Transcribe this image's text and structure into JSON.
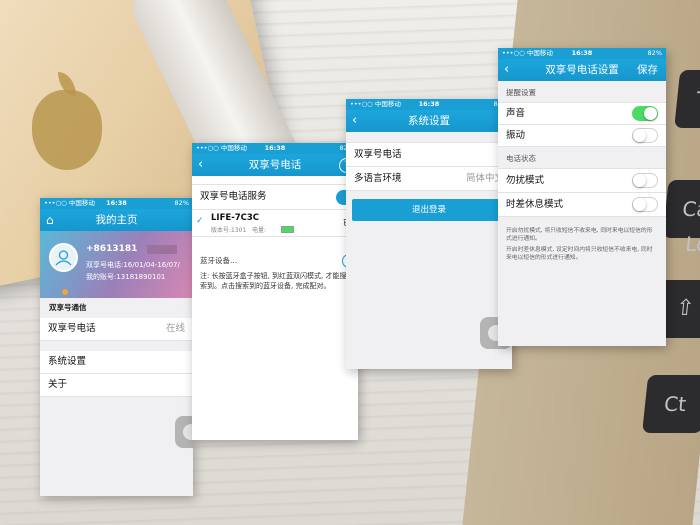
{
  "statusbar": {
    "carrier": "•••○○ 中国移动 ",
    "time": "16:38",
    "battery": "82%"
  },
  "screen1": {
    "title": "我的主页",
    "profile": {
      "phone": "+8613181",
      "date_line": "双享号电话:16/01/04-16/07/",
      "account_line": "我的账号:13181890101"
    },
    "section": "双享号通信",
    "rows": [
      {
        "label": "双享号电话",
        "value": "在线"
      },
      {
        "label": "系统设置"
      },
      {
        "label": "关于"
      }
    ]
  },
  "screen2": {
    "title": "双享号电话",
    "service_label": "双享号电话服务",
    "device": {
      "name": "LIFE-7C3C",
      "meta": "版本号:1301   电量:",
      "status": "已配"
    },
    "searching": "蓝牙设备...",
    "note": "注: 长按蓝牙盒子按钮, 到红蓝双闪模式, 才能搜索到。点击搜索到的蓝牙设备, 完成配对。"
  },
  "screen3": {
    "title": "系统设置",
    "rows": [
      {
        "label": "双享号电话"
      },
      {
        "label": "多语言环境",
        "value": "简体中文"
      }
    ],
    "logout": "退出登录"
  },
  "screen4": {
    "title": "双享号电话设置",
    "save": "保存",
    "reminder_section": "提醒设置",
    "sound": "声音",
    "vibrate": "振动",
    "status_section": "电话状态",
    "dnd": "勿扰模式",
    "timezone": "时差休息模式",
    "note1": "开启勿扰模式, 将只收短信不收来电, 同时来电以短信的形式进行通知。",
    "note2": "开启时差休息模式, 设定时间内将只收短信不收来电, 同时来电以短信的形式进行通知。",
    "toggles": {
      "sound": true,
      "vibrate": false,
      "dnd": false,
      "timezone": false
    }
  },
  "keys": [
    "Ta",
    "Ca",
    "Lo",
    "Ct"
  ],
  "colors": {
    "accent": "#1a9fd5",
    "toggle_on": "#4cd964"
  }
}
